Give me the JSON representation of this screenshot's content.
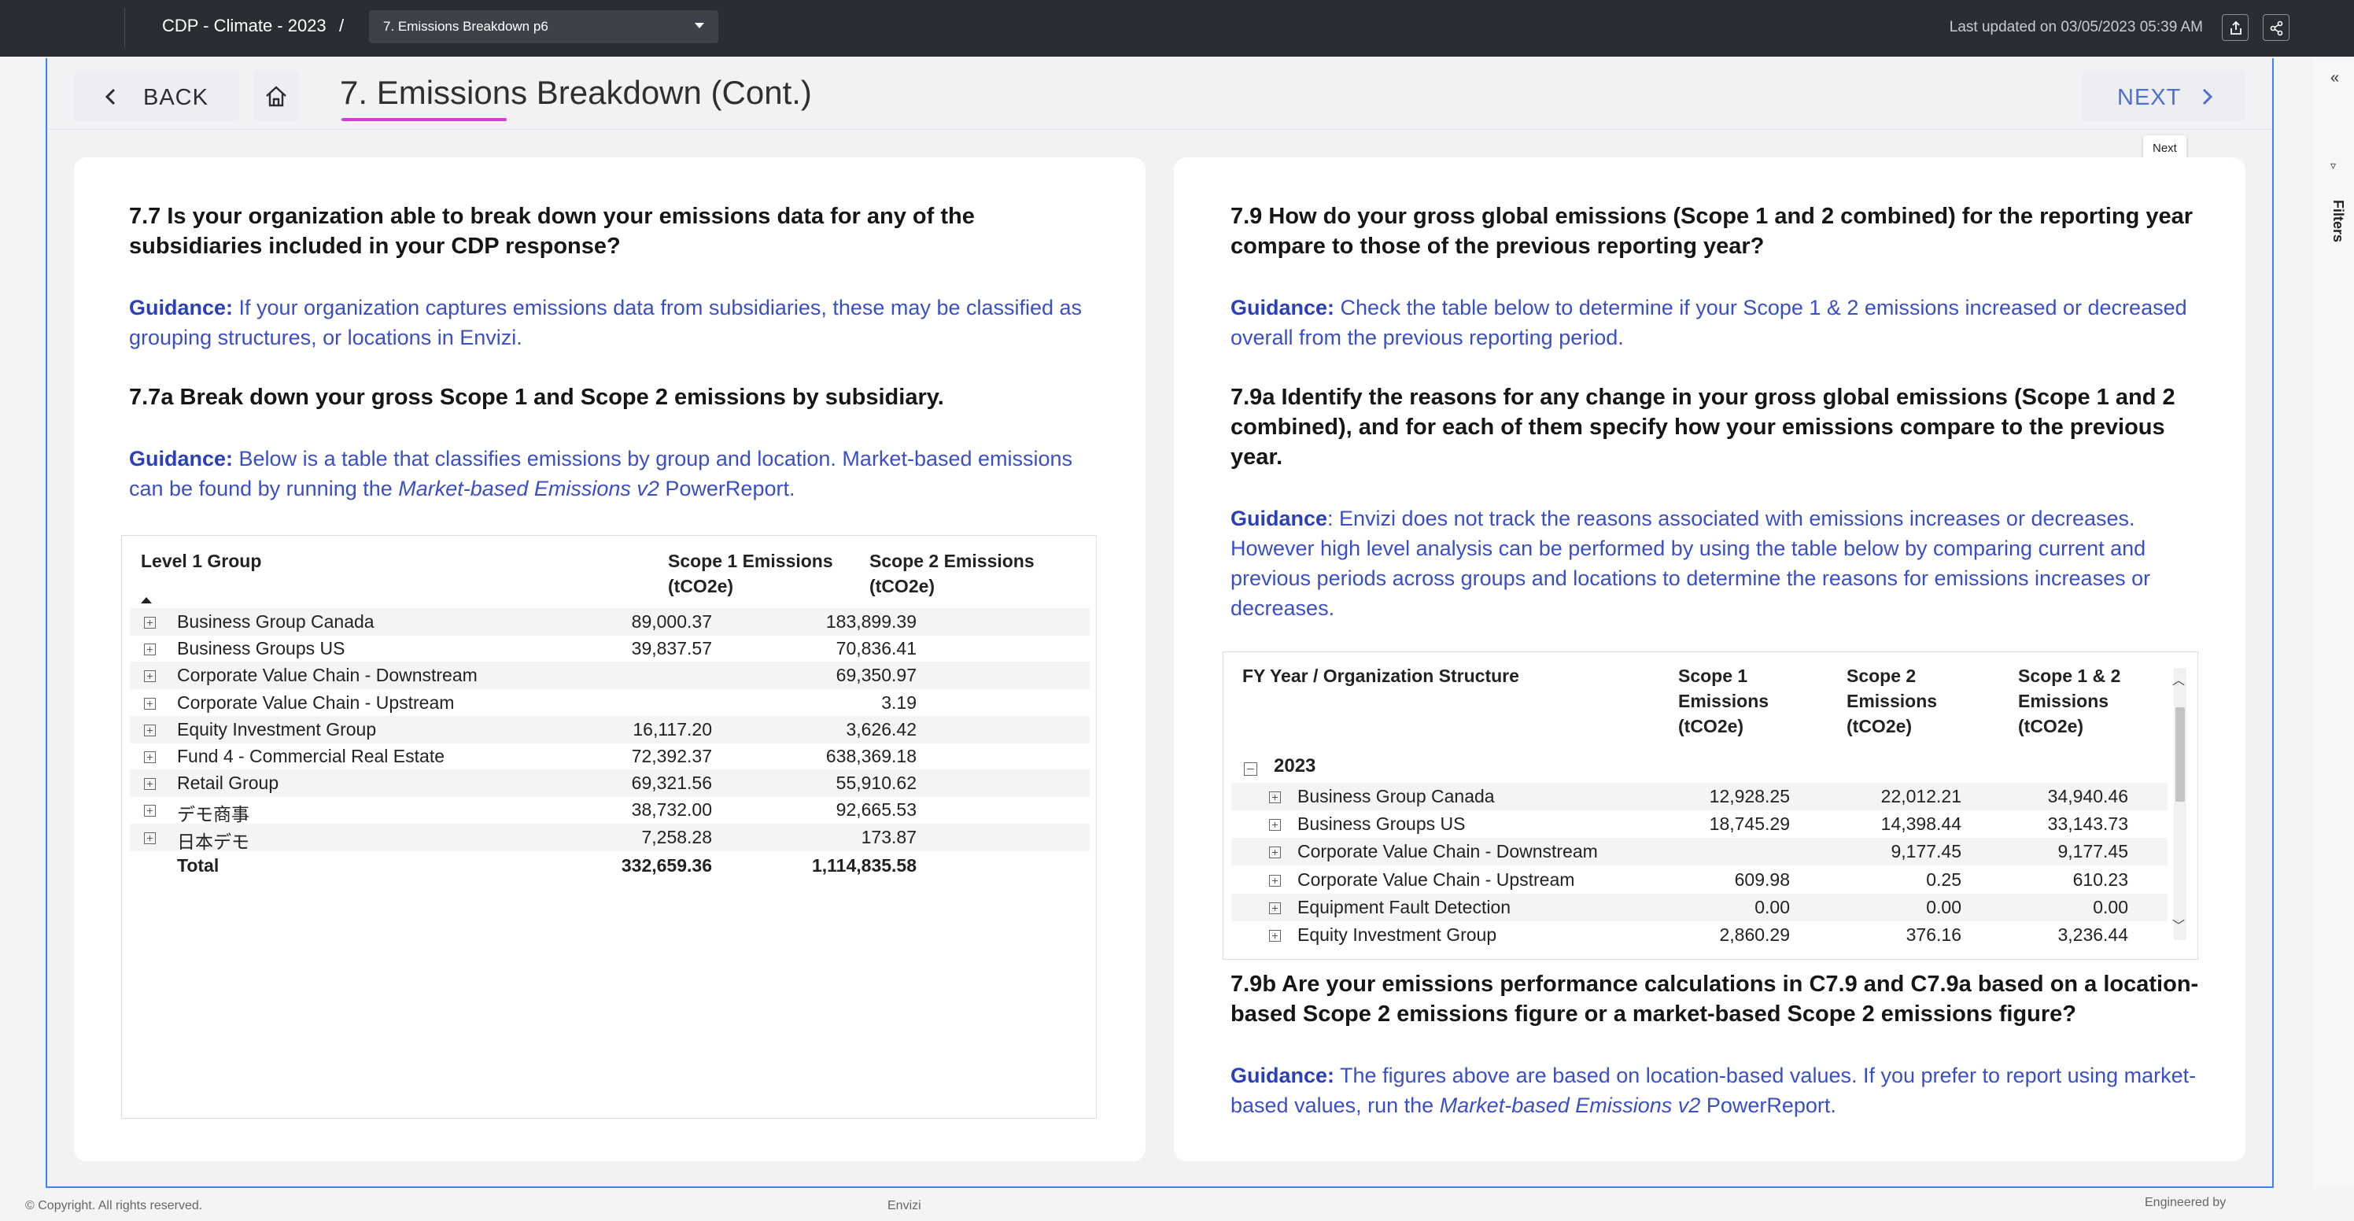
{
  "topbar": {
    "breadcrumb": "CDP - Climate - 2023",
    "separator": "/",
    "page_select": "7. Emissions Breakdown p6",
    "last_updated": "Last updated on 03/05/2023 05:39 AM",
    "icons": [
      "export-icon",
      "share-icon"
    ]
  },
  "header": {
    "back_label": "BACK",
    "title": "7. Emissions Breakdown (Cont.)",
    "next_label": "NEXT",
    "next_tooltip": "Next",
    "underline_color": "#d63cd6",
    "next_color": "#4c6fd6"
  },
  "filters": {
    "label": "Filters"
  },
  "left": {
    "q77": "7.7 Is your organization able to break down your emissions data for any of the subsidiaries included in your CDP response?",
    "g77_label": "Guidance:",
    "g77_text": " If your organization captures emissions data from subsidiaries, these may be classified as grouping structures, or locations in Envizi.",
    "q77a": "7.7a Break down your gross Scope 1 and Scope 2 emissions by subsidiary.",
    "g77a_label": "Guidance:",
    "g77a_text1": " Below is a table that classifies emissions by group and location. Market-based emissions can be found by running the ",
    "g77a_italic": "Market-based Emissions v2",
    "g77a_text2": " PowerReport.",
    "table": {
      "headers": [
        "Level 1 Group",
        "Scope 1 Emissions (tCO2e)",
        "Scope 2 Emissions (tCO2e)"
      ],
      "h1": "Level 1 Group",
      "h2a": "Scope 1 Emissions",
      "h2b": "(tCO2e)",
      "h3a": "Scope 2 Emissions",
      "h3b": "(tCO2e)",
      "rows": [
        {
          "name": "Business Group Canada",
          "s1": "89,000.37",
          "s2": "183,899.39"
        },
        {
          "name": "Business Groups US",
          "s1": "39,837.57",
          "s2": "70,836.41"
        },
        {
          "name": "Corporate Value Chain - Downstream",
          "s1": "",
          "s2": "69,350.97"
        },
        {
          "name": "Corporate Value Chain - Upstream",
          "s1": "",
          "s2": "3.19"
        },
        {
          "name": "Equity Investment Group",
          "s1": "16,117.20",
          "s2": "3,626.42"
        },
        {
          "name": "Fund 4 - Commercial Real Estate",
          "s1": "72,392.37",
          "s2": "638,369.18"
        },
        {
          "name": "Retail Group",
          "s1": "69,321.56",
          "s2": "55,910.62"
        },
        {
          "name": "デモ商事",
          "s1": "38,732.00",
          "s2": "92,665.53"
        },
        {
          "name": "日本デモ",
          "s1": "7,258.28",
          "s2": "173.87"
        }
      ],
      "total": {
        "name": "Total",
        "s1": "332,659.36",
        "s2": "1,114,835.58"
      }
    }
  },
  "right": {
    "q79": "7.9 How do your gross global emissions (Scope 1 and 2 combined) for the reporting year compare to those of the previous reporting year?",
    "g79_label": "Guidance:",
    "g79_text": " Check the table below to determine if your Scope 1 & 2 emissions increased or decreased overall from the previous reporting period.",
    "q79a": "7.9a Identify the reasons for any change in your gross global emissions (Scope 1 and 2 combined), and for each of them specify how your emissions compare to the previous year.",
    "g79a_label": "Guidance",
    "g79a_text": ": Envizi does not track the reasons associated with emissions increases or decreases. However high level analysis can be performed by using the table below by comparing current and previous periods across groups and locations to determine the reasons for emissions increases or decreases.",
    "q79b": "7.9b Are your emissions performance calculations in C7.9 and C7.9a based on a location-based Scope 2 emissions figure or a market-based Scope 2 emissions figure?",
    "g79b_label": "Guidance:",
    "g79b_text1": " The figures above are based on location-based values. If you prefer to report using market-based values, run the ",
    "g79b_italic": "Market-based Emissions v2",
    "g79b_text2": " PowerReport.",
    "table": {
      "h1": "FY Year / Organization Structure",
      "h2": [
        "Scope 1",
        "Emissions",
        "(tCO2e)"
      ],
      "h3": [
        "Scope 2",
        "Emissions",
        "(tCO2e)"
      ],
      "h4": [
        "Scope 1 & 2",
        "Emissions",
        "(tCO2e)"
      ],
      "year": "2023",
      "rows": [
        {
          "name": "Business Group Canada",
          "s1": "12,928.25",
          "s2": "22,012.21",
          "s12": "34,940.46"
        },
        {
          "name": "Business Groups US",
          "s1": "18,745.29",
          "s2": "14,398.44",
          "s12": "33,143.73"
        },
        {
          "name": "Corporate Value Chain - Downstream",
          "s1": "",
          "s2": "9,177.45",
          "s12": "9,177.45"
        },
        {
          "name": "Corporate Value Chain - Upstream",
          "s1": "609.98",
          "s2": "0.25",
          "s12": "610.23"
        },
        {
          "name": "Equipment Fault Detection",
          "s1": "0.00",
          "s2": "0.00",
          "s12": "0.00"
        },
        {
          "name": "Equity Investment Group",
          "s1": "2,860.29",
          "s2": "376.16",
          "s12": "3,236.44"
        }
      ]
    }
  },
  "footer": {
    "copyright": "© Copyright. All rights reserved.",
    "brand": "Envizi",
    "engineered": "Engineered by"
  },
  "colors": {
    "guidance_text": "#3a4fc6",
    "topbar_bg": "#2a2d34",
    "frame_border": "#3b82f6"
  }
}
